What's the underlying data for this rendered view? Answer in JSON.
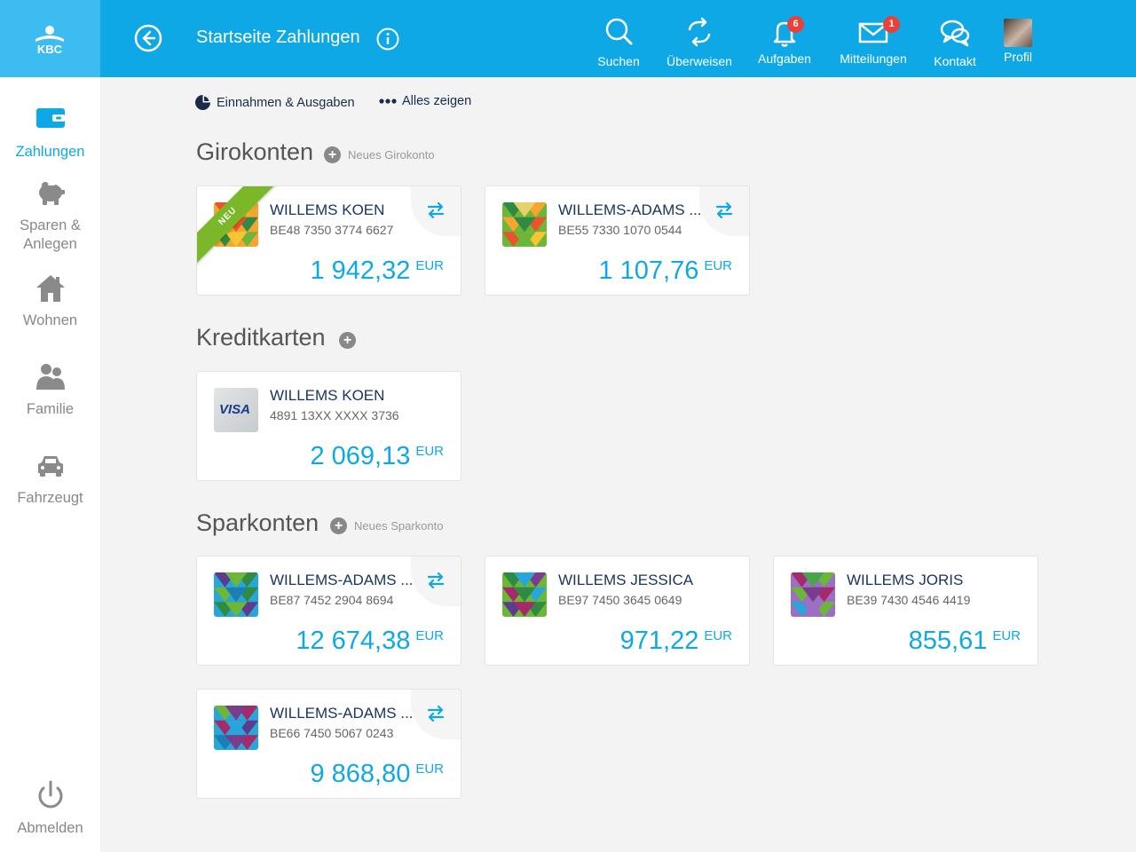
{
  "colors": {
    "primary": "#0fa8e6",
    "logo_bg": "#3cbcf0",
    "badge": "#e8413a",
    "ribbon": "#7ab829",
    "name": "#1a3560"
  },
  "brand": {
    "logo_text": "KBC"
  },
  "header": {
    "title": "Startseite Zahlungen",
    "nav": [
      {
        "label": "Suchen",
        "icon": "search-icon"
      },
      {
        "label": "Überweisen",
        "icon": "transfer-icon"
      },
      {
        "label": "Aufgaben",
        "icon": "bell-icon",
        "badge": "6"
      },
      {
        "label": "Mitteilungen",
        "icon": "envelope-icon",
        "badge": "1"
      },
      {
        "label": "Kontakt",
        "icon": "chat-icon"
      },
      {
        "label": "Profil",
        "icon": "avatar"
      }
    ]
  },
  "sidebar": {
    "items": [
      {
        "label": "Zahlungen",
        "icon": "wallet-icon",
        "active": true
      },
      {
        "label": "Sparen & Anlegen",
        "icon": "piggy-bank-icon"
      },
      {
        "label": "Wohnen",
        "icon": "house-icon"
      },
      {
        "label": "Familie",
        "icon": "family-icon"
      },
      {
        "label": "Fahrzeugt",
        "icon": "car-icon"
      }
    ],
    "logout": "Abmelden"
  },
  "quick_links": {
    "income_expenses": "Einnahmen & Ausgaben",
    "show_all": "Alles zeigen"
  },
  "sections": {
    "girokonten": {
      "title": "Girokonten",
      "add_label": "Neues Girokonto",
      "accounts": [
        {
          "name": "WILLEMS KOEN",
          "iban": "BE48 7350 3774 6627",
          "amount": "1 942,32",
          "currency": "EUR",
          "ribbon": "NEU"
        },
        {
          "name": "WILLEMS-ADAMS ...",
          "iban": "BE55 7330 1070 0544",
          "amount": "1 107,76",
          "currency": "EUR"
        }
      ]
    },
    "kreditkarten": {
      "title": "Kreditkarten",
      "cards": [
        {
          "name": "WILLEMS KOEN",
          "number": "4891 13XX XXXX 3736",
          "amount": "2 069,13",
          "currency": "EUR",
          "brand": "VISA"
        }
      ]
    },
    "sparkonten": {
      "title": "Sparkonten",
      "add_label": "Neues Sparkonto",
      "accounts": [
        {
          "name": "WILLEMS-ADAMS ...",
          "iban": "BE87 7452 2904 8694",
          "amount": "12 674,38",
          "currency": "EUR"
        },
        {
          "name": "WILLEMS JESSICA",
          "iban": "BE97 7450 3645 0649",
          "amount": "971,22",
          "currency": "EUR"
        },
        {
          "name": "WILLEMS JORIS",
          "iban": "BE39 7430 4546 4419",
          "amount": "855,61",
          "currency": "EUR"
        },
        {
          "name": "WILLEMS-ADAMS ...",
          "iban": "BE66 7450 5067 0243",
          "amount": "9 868,80",
          "currency": "EUR"
        }
      ]
    }
  }
}
